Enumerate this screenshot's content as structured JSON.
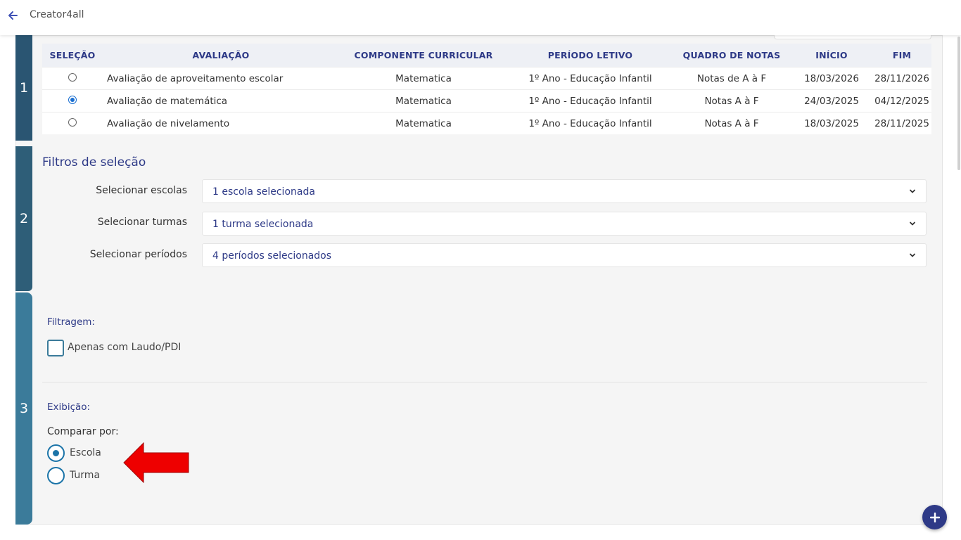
{
  "header": {
    "app_title": "Creator4all",
    "back_icon": "arrow-left-icon"
  },
  "steps": {
    "step1": "1",
    "step2": "2",
    "step3": "3"
  },
  "table": {
    "columns": [
      "SELEÇÃO",
      "AVALIAÇÃO",
      "COMPONENTE CURRICULAR",
      "PERÍODO LETIVO",
      "QUADRO DE NOTAS",
      "INÍCIO",
      "FIM"
    ],
    "rows": [
      {
        "selected": false,
        "avaliacao": "Avaliação de aproveitamento escolar",
        "componente": "Matematica",
        "periodo": "1º Ano - Educação Infantil",
        "quadro": "Notas de A à F",
        "inicio": "18/03/2026",
        "fim": "28/11/2026"
      },
      {
        "selected": true,
        "avaliacao": "Avaliação de matemática",
        "componente": "Matematica",
        "periodo": "1º Ano - Educação Infantil",
        "quadro": "Notas A à F",
        "inicio": "24/03/2025",
        "fim": "04/12/2025"
      },
      {
        "selected": false,
        "avaliacao": "Avaliação de nivelamento",
        "componente": "Matematica",
        "periodo": "1º Ano - Educação Infantil",
        "quadro": "Notas A à F",
        "inicio": "18/03/2025",
        "fim": "28/11/2025"
      }
    ]
  },
  "filters": {
    "title": "Filtros de seleção",
    "schools_label": "Selecionar escolas",
    "schools_value": "1 escola selecionada",
    "classes_label": "Selecionar turmas",
    "classes_value": "1 turma selecionada",
    "periods_label": "Selecionar períodos",
    "periods_value": "4 períodos selecionados"
  },
  "filtragem": {
    "title": "Filtragem:",
    "checkbox_label": "Apenas com Laudo/PDI",
    "checked": false
  },
  "exibicao": {
    "title": "Exibição:",
    "compare_label": "Comparar por:",
    "options": [
      {
        "label": "Escola",
        "selected": true
      },
      {
        "label": "Turma",
        "selected": false
      }
    ]
  },
  "colors": {
    "primary": "#2e3a87",
    "step_dark": "#2a5572",
    "step_light": "#3b7b9a",
    "annotation_arrow": "#ee0000"
  }
}
